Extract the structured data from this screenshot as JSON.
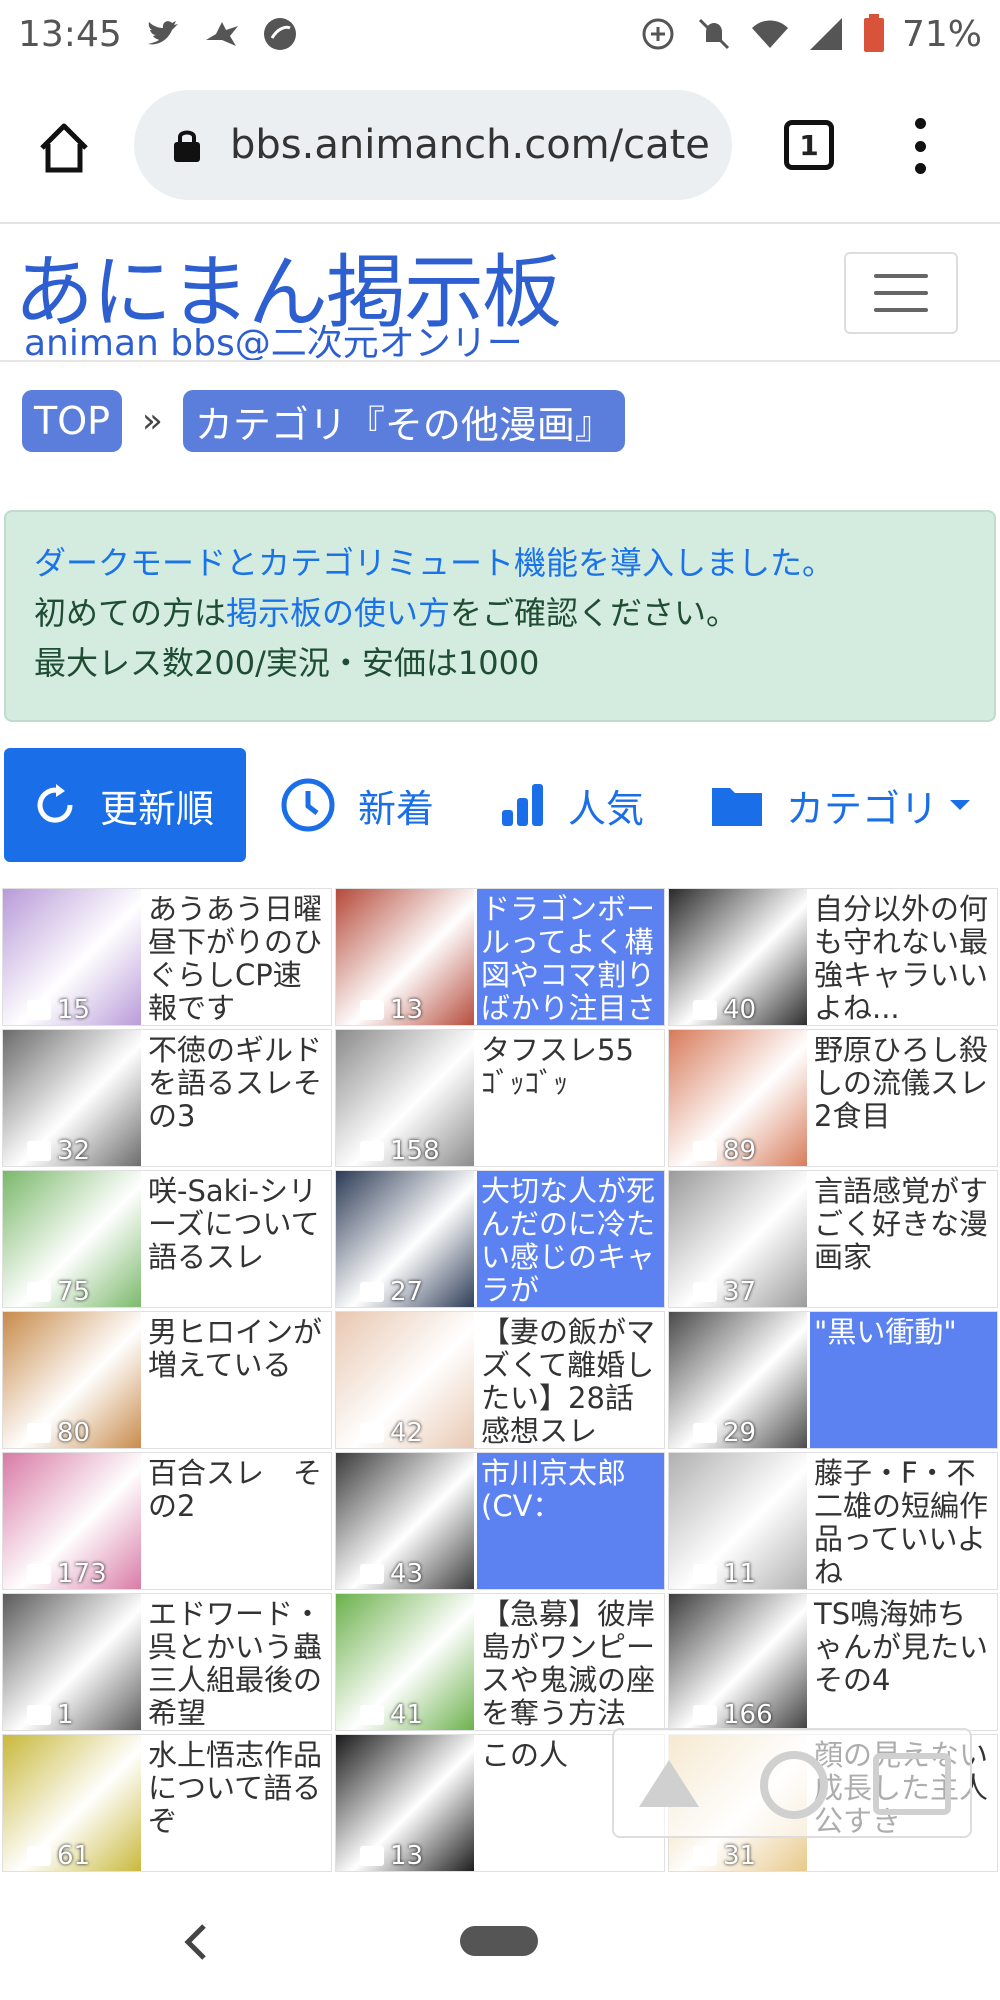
{
  "status_bar": {
    "time": "13:45",
    "battery": "71%"
  },
  "browser": {
    "url": "bbs.animanch.com/cate",
    "tab_count": "1"
  },
  "site": {
    "logo_main": "あにまん掲示板",
    "logo_sub": "animan bbs@二次元オンリー"
  },
  "breadcrumb": {
    "top": "TOP",
    "separator": "»",
    "category": "カテゴリ『その他漫画』"
  },
  "notice": {
    "line1": "ダークモードとカテゴリミュート機能を導入しました。",
    "line2_prefix": "初めての方は",
    "line2_link": "掲示板の使い方",
    "line2_suffix": "をご確認ください。",
    "line3": "最大レス数200/実況・安価は1000"
  },
  "sort_tabs": {
    "update": "更新順",
    "new": "新着",
    "popular": "人気",
    "category": "カテゴリ"
  },
  "accent_color": "#1a6fe8",
  "highlight_color": "#5b82f0",
  "threads": [
    {
      "title": "あうあう日曜昼下がりのひぐらしCP速報です",
      "count": "15",
      "highlight": false,
      "color": "#b89ad9"
    },
    {
      "title": "ドラゴンボールってよく構図やコマ割りばかり注目さ",
      "count": "13",
      "highlight": true,
      "color": "#b54a3a"
    },
    {
      "title": "自分以外の何も守れない最強キャラいいよね...",
      "count": "40",
      "highlight": false,
      "color": "#2a2a2a"
    },
    {
      "title": "不徳のギルドを語るスレその3",
      "count": "32",
      "highlight": false,
      "color": "#6a6a6a"
    },
    {
      "title": "タフスレ55 ｺﾞｯｺﾞｯ",
      "count": "158",
      "highlight": false,
      "color": "#8a8a8a"
    },
    {
      "title": "野原ひろし殺しの流儀スレ2食目",
      "count": "89",
      "highlight": false,
      "color": "#d77a5a"
    },
    {
      "title": "咲-Saki-シリーズについて語るスレ",
      "count": "75",
      "highlight": false,
      "color": "#7ab86a"
    },
    {
      "title": "大切な人が死んだのに冷たい感じのキャラが",
      "count": "27",
      "highlight": true,
      "color": "#2b3a55"
    },
    {
      "title": "言語感覚がすごく好きな漫画家",
      "count": "37",
      "highlight": false,
      "color": "#9a9a9a"
    },
    {
      "title": "男ヒロインが増えている",
      "count": "80",
      "highlight": false,
      "color": "#c88a4a"
    },
    {
      "title": "【妻の飯がマズくて離婚したい】28話感想スレ",
      "count": "42",
      "highlight": false,
      "color": "#e8c7b0"
    },
    {
      "title": "\"黒い衝動\"",
      "count": "29",
      "highlight": true,
      "color": "#4a4a4a"
    },
    {
      "title": "百合スレ　その2",
      "count": "173",
      "highlight": false,
      "color": "#d87aa5"
    },
    {
      "title": "市川京太郎(CV：",
      "count": "43",
      "highlight": true,
      "color": "#3a3a3a"
    },
    {
      "title": "藤子・F・不二雄の短編作品っていいよね",
      "count": "11",
      "highlight": false,
      "color": "#b0b0b0"
    },
    {
      "title": "エドワード・呉とかいう蟲三人組最後の希望",
      "count": "1",
      "highlight": false,
      "color": "#5a5a5a"
    },
    {
      "title": "【急募】彼岸島がワンピースや鬼滅の座を奪う方法",
      "count": "41",
      "highlight": false,
      "color": "#6ab04a"
    },
    {
      "title": "TS鳴海姉ちゃんが見たいその4",
      "count": "166",
      "highlight": false,
      "color": "#3d3d3d"
    },
    {
      "title": "水上悟志作品について語るぞ",
      "count": "61",
      "highlight": false,
      "color": "#c8b83a"
    },
    {
      "title": "この人",
      "count": "13",
      "highlight": false,
      "color": "#1a1a1a"
    },
    {
      "title": "顔の見えない成長した主人公すき",
      "count": "31",
      "highlight": false,
      "color": "#e8c88a"
    }
  ]
}
